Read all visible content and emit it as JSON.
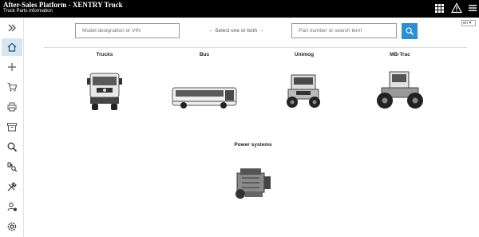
{
  "header": {
    "app_title": "After-Sales Platform - XENTRY Truck",
    "subtitle": "Truck Parts information",
    "icons": [
      "grid-icon",
      "warning-icon",
      "menu-icon"
    ]
  },
  "sidebar": {
    "items": [
      {
        "icon": "expand-chevrons-icon"
      },
      {
        "icon": "home-icon",
        "active": true
      },
      {
        "icon": "plus-icon"
      },
      {
        "icon": "cart-icon"
      },
      {
        "icon": "printer-icon"
      },
      {
        "icon": "archive-icon"
      },
      {
        "icon": "search-icon"
      },
      {
        "icon": "parts-search-icon"
      },
      {
        "icon": "tools-icon"
      },
      {
        "icon": "user-info-icon"
      },
      {
        "icon": "settings-icon"
      }
    ]
  },
  "search": {
    "vin_placeholder": "Model designation or VIN",
    "hint": "← Select one or both →",
    "part_placeholder": "Part number or search term",
    "language": "en"
  },
  "categories": [
    {
      "label": "Trucks",
      "icon": "truck-image"
    },
    {
      "label": "Bus",
      "icon": "bus-image"
    },
    {
      "label": "Unimog",
      "icon": "unimog-image"
    },
    {
      "label": "MB-Trac",
      "icon": "tractor-image"
    },
    {
      "label": "Power systems",
      "icon": "engine-image"
    }
  ]
}
